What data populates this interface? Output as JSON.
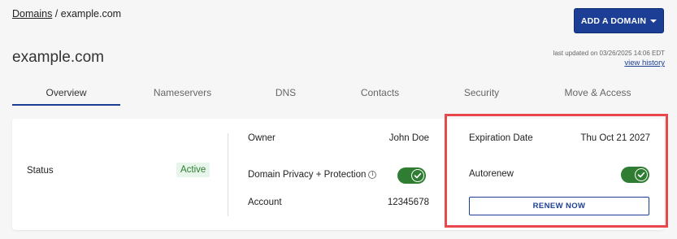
{
  "breadcrumb": {
    "root": "Domains",
    "separator": " / ",
    "current": "example.com"
  },
  "header": {
    "add_domain_label": "ADD A DOMAIN",
    "title": "example.com"
  },
  "updated": {
    "text": "last updated on 03/26/2025 14:06 EDT",
    "view_history": "view history"
  },
  "tabs": [
    {
      "label": "Overview",
      "active": true
    },
    {
      "label": "Nameservers"
    },
    {
      "label": "DNS"
    },
    {
      "label": "Contacts"
    },
    {
      "label": "Security"
    },
    {
      "label": "Move & Access"
    }
  ],
  "status": {
    "label": "Status",
    "value": "Active"
  },
  "owner": {
    "label": "Owner",
    "value": "John Doe"
  },
  "privacy": {
    "label": "Domain Privacy + Protection",
    "enabled": true
  },
  "account": {
    "label": "Account",
    "value": "12345678"
  },
  "expiration": {
    "label": "Expiration Date",
    "value": "Thu Oct 21 2027"
  },
  "autorenew": {
    "label": "Autorenew",
    "enabled": true
  },
  "renew_label": "RENEW NOW",
  "colors": {
    "brand": "#1c3f95",
    "success": "#2e7d32",
    "highlight": "#e8474d"
  }
}
